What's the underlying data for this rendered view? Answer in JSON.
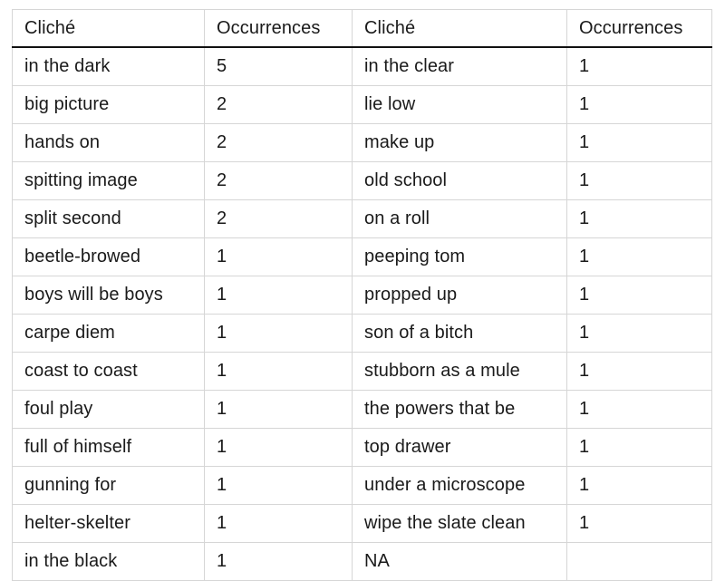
{
  "table": {
    "name": "cliche-occurrences-table",
    "headers": [
      "Cliché",
      "Occurrences",
      "Cliché",
      "Occurrences"
    ],
    "rows": [
      [
        "in the dark",
        "5",
        "in the clear",
        "1"
      ],
      [
        "big picture",
        "2",
        "lie low",
        "1"
      ],
      [
        "hands on",
        "2",
        "make up",
        "1"
      ],
      [
        "spitting image",
        "2",
        "old school",
        "1"
      ],
      [
        "split second",
        "2",
        "on a roll",
        "1"
      ],
      [
        "beetle-browed",
        "1",
        "peeping tom",
        "1"
      ],
      [
        "boys will be boys",
        "1",
        "propped up",
        "1"
      ],
      [
        "carpe diem",
        "1",
        "son of a bitch",
        "1"
      ],
      [
        "coast to coast",
        "1",
        "stubborn as a mule",
        "1"
      ],
      [
        "foul play",
        "1",
        "the powers that be",
        "1"
      ],
      [
        "full of himself",
        "1",
        "top drawer",
        "1"
      ],
      [
        "gunning for",
        "1",
        "under a microscope",
        "1"
      ],
      [
        "helter-skelter",
        "1",
        "wipe the slate clean",
        "1"
      ],
      [
        "in the black",
        "1",
        "NA",
        ""
      ]
    ]
  },
  "colors": {
    "text": "#1a1a1a",
    "grid_line": "#d6d6d6",
    "header_rule": "#111111",
    "background": "#ffffff"
  }
}
